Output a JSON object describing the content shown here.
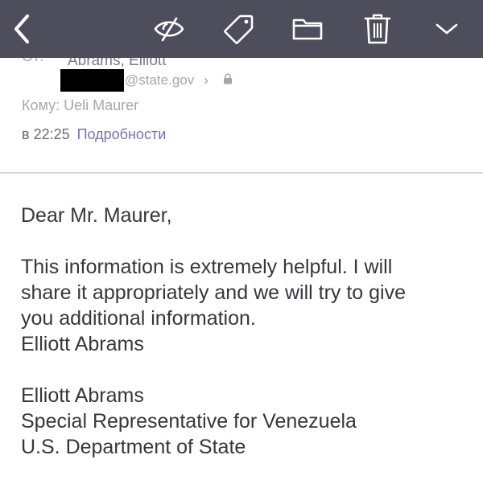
{
  "toolbar": {
    "back_icon": "chevron-left-icon",
    "hide_icon": "eye-slash-icon",
    "tag_icon": "tag-icon",
    "folder_icon": "folder-icon",
    "trash_icon": "trash-icon",
    "more_icon": "chevron-down-icon",
    "background": "#4e4d5b"
  },
  "header": {
    "from_label": "От:",
    "from_name": "Abrams, Elliott",
    "from_email_domain": "@state.gov",
    "from_email_chevron": "›",
    "to_line": "Кому: Ueli Maurer",
    "time": "в 22:25",
    "details_link": "Подробности",
    "link_color": "#7473b8"
  },
  "message": {
    "greeting": "Dear Mr. Maurer,",
    "paragraph_lines": [
      "This information is extremely helpful. I will",
      "share it appropriately and we will try to give",
      "you additional information.",
      "Elliott Abrams"
    ],
    "signature_lines": [
      "Elliott Abrams",
      "Special Representative for Venezuela",
      "U.S. Department of State"
    ]
  }
}
